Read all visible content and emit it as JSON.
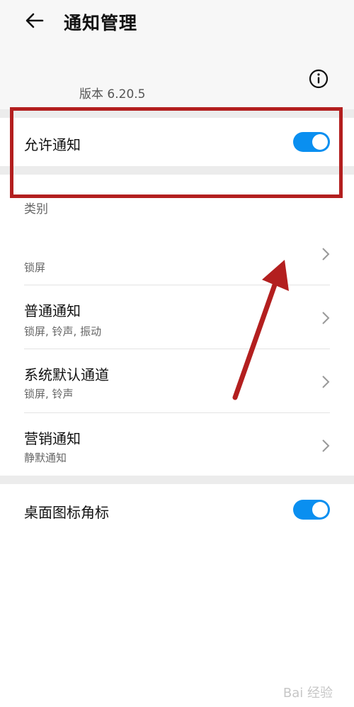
{
  "header": {
    "title": "通知管理"
  },
  "app": {
    "version": "版本 6.20.5"
  },
  "allow_notifications": {
    "label": "允许通知",
    "enabled": true
  },
  "categories": {
    "label": "类别",
    "items": [
      {
        "title": "",
        "subtitle": "锁屏"
      },
      {
        "title": "普通通知",
        "subtitle": "锁屏, 铃声, 振动"
      },
      {
        "title": "系统默认通道",
        "subtitle": "锁屏, 铃声"
      },
      {
        "title": "营销通知",
        "subtitle": "静默通知"
      }
    ]
  },
  "badge": {
    "label": "桌面图标角标",
    "enabled": true
  },
  "watermark": {
    "text": "Bai 经验"
  },
  "colors": {
    "toggle_on": "#0a8ff0",
    "annotation": "#b31f1f"
  }
}
